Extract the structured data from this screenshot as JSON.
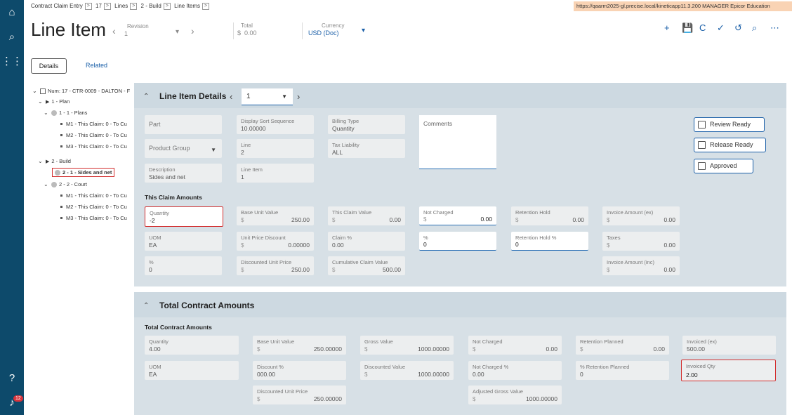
{
  "breadcrumb": [
    "Contract Claim Entry",
    "17",
    "Lines",
    "2 - Build",
    "Line Items"
  ],
  "crumb_sep": ">",
  "url_bar": "https://qaarm2025-gl.precise.local/kineticapp11.3.200 MANAGER Epicor Education",
  "header": {
    "title": "Line Item",
    "revision_label": "Revision",
    "revision_value": "1",
    "total_label": "Total",
    "total_currency": "$",
    "total_value": "0.00",
    "currency_label": "Currency",
    "currency_value": "USD (Doc)"
  },
  "toolbar": {
    "add": "+",
    "save": "💾",
    "refresh": "C",
    "actions": "✓",
    "undo": "↺",
    "search": "⌕",
    "more": "⋯"
  },
  "tabs": {
    "details": "Details",
    "related": "Related"
  },
  "tree": [
    {
      "label": "Num: 17 - CTR-0009 - DALTON - F",
      "level": 0
    },
    {
      "label": "1 - Plan",
      "level": 1
    },
    {
      "label": "1 - 1 - Plans",
      "level": 2
    },
    {
      "label": "M1 - This Claim: 0 - To Cu",
      "level": 3
    },
    {
      "label": "M2 - This Claim: 0 - To Cu",
      "level": 3
    },
    {
      "label": "M3 - This Claim: 0 - To Cu",
      "level": 3
    },
    {
      "label": "2 - Build",
      "level": 1
    },
    {
      "label": "2 - 1 - Sides and net",
      "level": 2
    },
    {
      "label": "2 - 2 - Court",
      "level": 2
    },
    {
      "label": "M1 - This Claim: 0 - To Cu",
      "level": 3
    },
    {
      "label": "M2 - This Claim: 0 - To Cu",
      "level": 3
    },
    {
      "label": "M3 - This Claim: 0 - To Cu",
      "level": 3
    }
  ],
  "details": {
    "title": "Line Item Details",
    "page_value": "1",
    "part_label": "Part",
    "display_sort_label": "Display Sort Sequence",
    "display_sort_value": "10.00000",
    "billing_type_label": "Billing Type",
    "billing_type_value": "Quantity",
    "comments_label": "Comments",
    "product_group_label": "Product Group",
    "line_label": "Line",
    "line_value": "2",
    "tax_liability_label": "Tax Liability",
    "tax_liability_value": "ALL",
    "description_label": "Description",
    "description_value": "Sides and net",
    "line_item_label": "Line Item",
    "line_item_value": "1",
    "review_ready": "Review Ready",
    "release_ready": "Release Ready",
    "approved": "Approved"
  },
  "claim": {
    "section_label": "This Claim Amounts",
    "currency": "$",
    "quantity_label": "Quantity",
    "quantity_value": "-2",
    "base_unit_label": "Base Unit Value",
    "base_unit_value": "250.00",
    "this_claim_label": "This Claim Value",
    "this_claim_value": "0.00",
    "not_charged_label": "Not Charged",
    "not_charged_value": "0.00",
    "retention_hold_label": "Retention Hold",
    "retention_hold_value": "0.00",
    "invoice_ex_label": "Invoice Amount (ex)",
    "invoice_ex_value": "0.00",
    "uom_label": "UOM",
    "uom_value": "EA",
    "unit_price_discount_label": "Unit Price Discount",
    "unit_price_discount_value": "0.00000",
    "claim_pct_label": "Claim %",
    "claim_pct_value": "0.00",
    "pct_label": "%",
    "pct_value": "0",
    "retention_hold_pct_label": "Retention Hold %",
    "retention_hold_pct_value": "0",
    "taxes_label": "Taxes",
    "taxes_value": "0.00",
    "pct2_label": "%",
    "pct2_value": "0",
    "discounted_unit_label": "Discounted Unit Price",
    "discounted_unit_value": "250.00",
    "cumulative_label": "Cumulative Claim Value",
    "cumulative_value": "500.00",
    "invoice_inc_label": "Invoice Amount (inc)",
    "invoice_inc_value": "0.00"
  },
  "totals": {
    "title": "Total Contract Amounts",
    "section_label": "Total Contract Amounts",
    "currency": "$",
    "quantity_label": "Quantity",
    "quantity_value": "4.00",
    "base_unit_label": "Base Unit Value",
    "base_unit_value": "250.00000",
    "gross_label": "Gross Value",
    "gross_value": "1000.00000",
    "not_charged_label": "Not Charged",
    "not_charged_value": "0.00",
    "retention_planned_label": "Retention Planned",
    "retention_planned_value": "0.00",
    "invoiced_ex_label": "Invoiced (ex)",
    "invoiced_ex_value": "500.00",
    "uom_label": "UOM",
    "uom_value": "EA",
    "discount_pct_label": "Discount %",
    "discount_pct_value": "000.00",
    "discounted_value_label": "Discounted Value",
    "discounted_value_value": "1000.00000",
    "not_charged_pct_label": "Not Charged %",
    "not_charged_pct_value": "0.00",
    "pct_retention_planned_label": "% Retention Planned",
    "pct_retention_planned_value": "0",
    "invoiced_qty_label": "Invoiced Qty",
    "invoiced_qty_value": "2.00",
    "discounted_unit_label": "Discounted Unit Price",
    "discounted_unit_value": "250.00000",
    "adjusted_gross_label": "Adjusted Gross Value",
    "adjusted_gross_value": "1000.00000"
  },
  "notifications_count": "12"
}
